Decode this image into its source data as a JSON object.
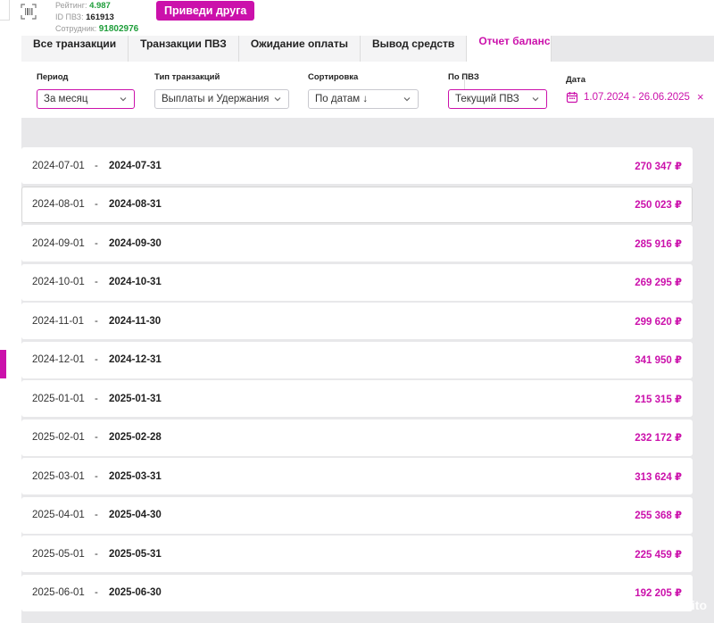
{
  "header": {
    "rating_label": "Рейтинг:",
    "rating_value": "4.987",
    "pvz_label": "ID ПВЗ:",
    "pvz_value": "161913",
    "employee_label": "Сотрудник:",
    "employee_value": "91802976",
    "invite_label": "Приведи друга"
  },
  "tabs": [
    {
      "label": "Все транзакции"
    },
    {
      "label": "Транзакции ПВЗ"
    },
    {
      "label": "Ожидание оплаты"
    },
    {
      "label": "Вывод средств"
    },
    {
      "label": "Отчет баланс"
    }
  ],
  "filters": {
    "period": {
      "label": "Период",
      "value": "За месяц"
    },
    "type": {
      "label": "Тип транзакций",
      "value": "Выплаты и Удержания"
    },
    "sort": {
      "label": "Сортировка",
      "value": "По датам ↓"
    },
    "pvz": {
      "label": "По ПВЗ",
      "value": "Текущий ПВЗ"
    },
    "date": {
      "label": "Дата",
      "value": "1.07.2024 - 26.06.2025",
      "clear": "×"
    }
  },
  "rows": [
    {
      "from": "2024-07-01",
      "to": "2024-07-31",
      "amount": "270 347 ₽"
    },
    {
      "from": "2024-08-01",
      "to": "2024-08-31",
      "amount": "250 023 ₽"
    },
    {
      "from": "2024-09-01",
      "to": "2024-09-30",
      "amount": "285 916 ₽"
    },
    {
      "from": "2024-10-01",
      "to": "2024-10-31",
      "amount": "269 295 ₽"
    },
    {
      "from": "2024-11-01",
      "to": "2024-11-30",
      "amount": "299 620 ₽"
    },
    {
      "from": "2024-12-01",
      "to": "2024-12-31",
      "amount": "341 950 ₽"
    },
    {
      "from": "2025-01-01",
      "to": "2025-01-31",
      "amount": "215 315 ₽"
    },
    {
      "from": "2025-02-01",
      "to": "2025-02-28",
      "amount": "232 172 ₽"
    },
    {
      "from": "2025-03-01",
      "to": "2025-03-31",
      "amount": "313 624 ₽"
    },
    {
      "from": "2025-04-01",
      "to": "2025-04-30",
      "amount": "255 368 ₽"
    },
    {
      "from": "2025-05-01",
      "to": "2025-05-31",
      "amount": "225 459 ₽"
    },
    {
      "from": "2025-06-01",
      "to": "2025-06-30",
      "amount": "192 205 ₽"
    }
  ],
  "row_separator": "-",
  "watermark": "Avito",
  "colors": {
    "accent": "#cb11ab",
    "green": "#1f9e3b",
    "panel": "#e8e8ea"
  }
}
